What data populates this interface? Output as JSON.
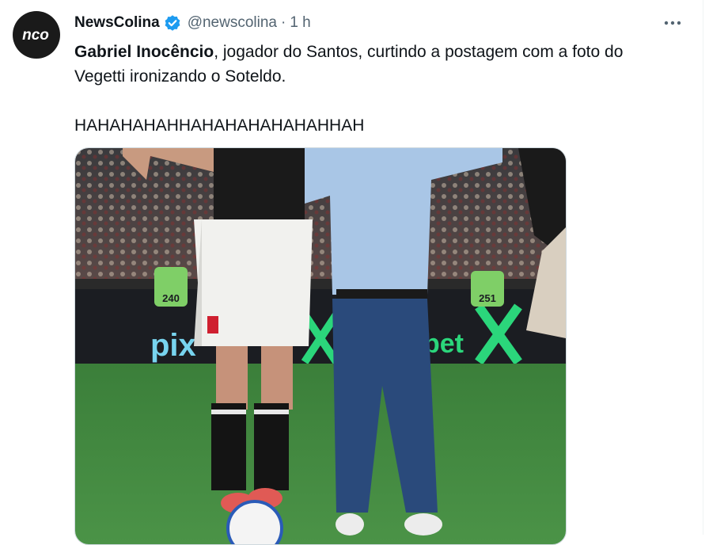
{
  "tweet": {
    "author": {
      "display_name": "NewsColina",
      "handle": "@newscolina",
      "avatar_text": "nco",
      "verified": true
    },
    "separator": "·",
    "time": "1 h",
    "more_icon": "more-horizontal-icon",
    "text": {
      "bold_name": "Gabriel Inocêncio",
      "line1_rest": ", jogador do Santos, curtindo a postagem com a foto do",
      "line2": "Vegetti ironizando o Soteldo.",
      "line3": "HAHAHAHAHHAHAHAHAHAHAHHAH"
    },
    "media": {
      "banner_left": "pix",
      "banner_right": "bet",
      "sign_numbers": [
        "240",
        "251"
      ]
    }
  },
  "colors": {
    "text": "#0f1419",
    "muted": "#536471",
    "verified_blue": "#1d9bf0",
    "grass": "#3f8a3e"
  }
}
